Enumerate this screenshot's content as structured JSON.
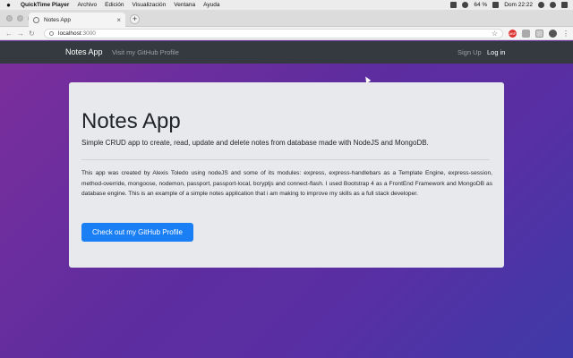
{
  "os_menubar": {
    "app_name": "QuickTime Player",
    "items": [
      "Archivo",
      "Edición",
      "Visualización",
      "Ventana",
      "Ayuda"
    ],
    "battery": "64 %",
    "clock": "Dom 22:22"
  },
  "browser": {
    "tab_title": "Notes App",
    "tab_close": "×",
    "new_tab": "+",
    "url_host": "localhost",
    "url_port": ":3000",
    "back": "←",
    "forward": "→",
    "reload": "↻",
    "star": "☆",
    "menu": "⋮",
    "ext_abp": "ABP"
  },
  "navbar": {
    "brand": "Notes App",
    "github_link": "Visit my GitHub Profile",
    "signup": "Sign Up",
    "login": "Log in"
  },
  "jumbotron": {
    "title": "Notes App",
    "lead": "Simple CRUD app to create, read, update and delete notes from database made with NodeJS and MongoDB.",
    "description": "This app was created by Alexis Toledo using nodeJS and some of its modules: express, express-handlebars as a Template Engine, express-session, method-override, mongoose, nodemon, passport, passport-local, bcryptjs and connect-flash. I used Bootstrap 4 as a FrontEnd Framework and MongoDB as database engine. This is an example of a simple notes application that i am making to improve my skills as a full stack developer.",
    "button": "Check out my GitHub Profile"
  },
  "colors": {
    "navbar_bg": "#343a40",
    "primary_button": "#1a7ef5",
    "card_bg": "#e8e9ec",
    "gradient_start": "#7b2e9c",
    "gradient_end": "#3f3aa8"
  },
  "icons": [
    "apple-icon",
    "wifi-icon",
    "battery-icon",
    "search-icon",
    "favicon-icon",
    "lock-icon",
    "star-icon",
    "extension-icon",
    "avatar-icon"
  ]
}
